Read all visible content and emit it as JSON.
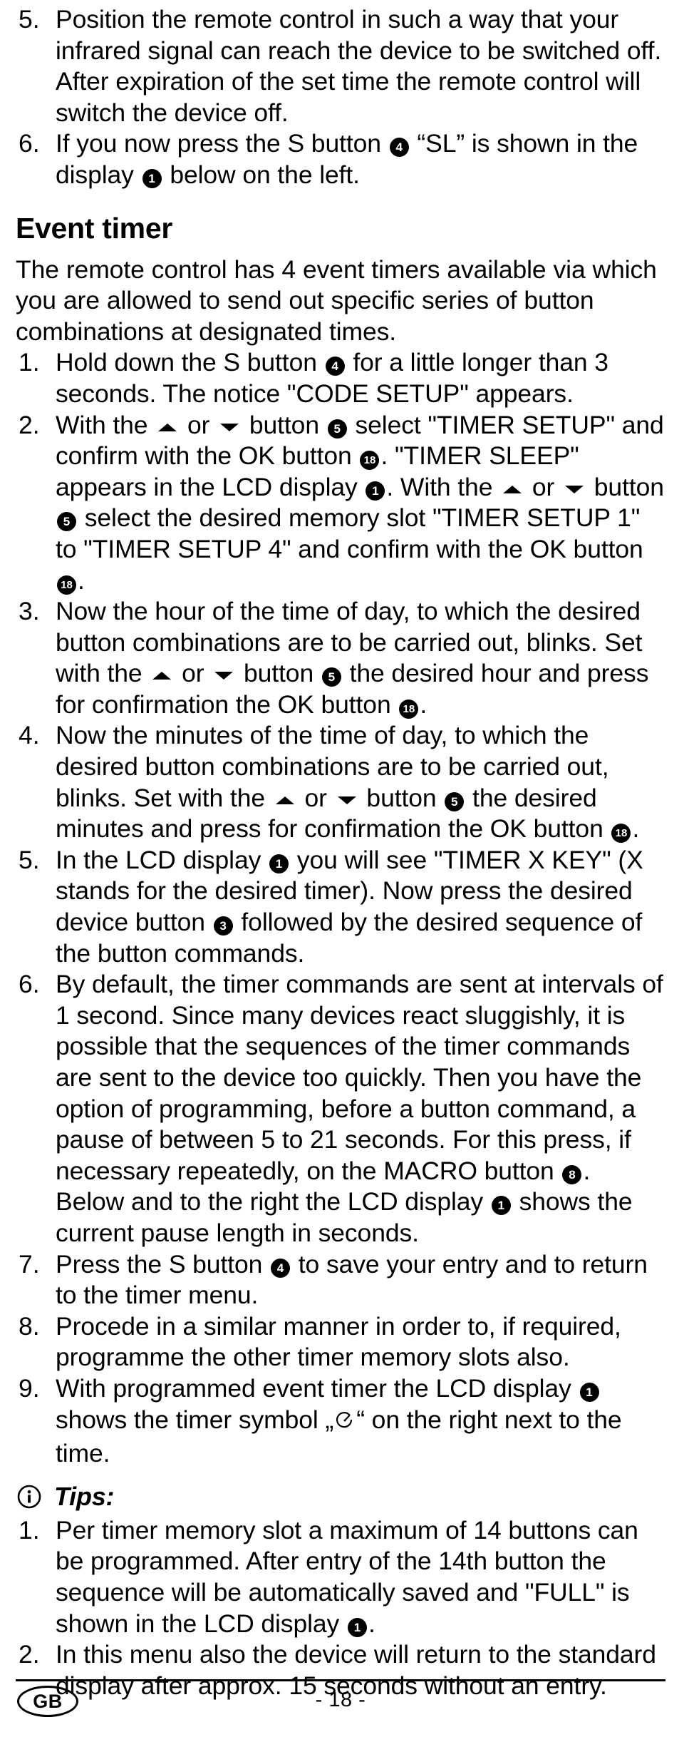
{
  "document": {
    "language_badge": "GB",
    "page_number": "- 18 -"
  },
  "continued_list": {
    "items": [
      {
        "number": "5.",
        "text_parts": [
          {
            "type": "text",
            "value": "Position the remote control in such a way that your infrared signal can reach the device to be switched off. After expiration of the set time the remote control will switch the device off."
          }
        ]
      },
      {
        "number": "6.",
        "text_parts": [
          {
            "type": "text",
            "value": "If you now press the S button "
          },
          {
            "type": "badge",
            "value": "4"
          },
          {
            "type": "text",
            "value": " “SL” is shown in the display "
          },
          {
            "type": "badge",
            "value": "1"
          },
          {
            "type": "text",
            "value": " below on the left."
          }
        ]
      }
    ]
  },
  "section": {
    "heading": "Event timer",
    "intro": "The remote control has 4 event timers available via which you are allowed to send out specific series of button combinations at designated times.",
    "items": [
      {
        "number": "1.",
        "text_parts": [
          {
            "type": "text",
            "value": "Hold down the S button "
          },
          {
            "type": "badge",
            "value": "4"
          },
          {
            "type": "text",
            "value": " for a little longer than 3 seconds. The notice \"CODE SETUP\" appears."
          }
        ]
      },
      {
        "number": "2.",
        "text_parts": [
          {
            "type": "text",
            "value": "With the "
          },
          {
            "type": "arrow-up",
            "value": "▲"
          },
          {
            "type": "text",
            "value": " or "
          },
          {
            "type": "arrow-down",
            "value": "▼"
          },
          {
            "type": "text",
            "value": " button "
          },
          {
            "type": "badge",
            "value": "5"
          },
          {
            "type": "text",
            "value": " select \"TIMER SETUP\" and confirm with the OK button "
          },
          {
            "type": "badge",
            "value": "18"
          },
          {
            "type": "text",
            "value": ". \"TIMER SLEEP\" appears in the LCD display "
          },
          {
            "type": "badge",
            "value": "1"
          },
          {
            "type": "text",
            "value": ".  With the "
          },
          {
            "type": "arrow-up",
            "value": "▲"
          },
          {
            "type": "text",
            "value": " or "
          },
          {
            "type": "arrow-down",
            "value": "▼"
          },
          {
            "type": "text",
            "value": " button "
          },
          {
            "type": "badge",
            "value": "5"
          },
          {
            "type": "text",
            "value": " select the desired memory slot \"TIMER SETUP 1\" to \"TIMER SETUP 4\" and confirm with the OK button "
          },
          {
            "type": "badge",
            "value": "18"
          },
          {
            "type": "text",
            "value": "."
          }
        ]
      },
      {
        "number": "3.",
        "text_parts": [
          {
            "type": "text",
            "value": "Now the hour of the time of day, to which the desired button combinations are to be carried out, blinks. Set with the "
          },
          {
            "type": "arrow-up",
            "value": "▲"
          },
          {
            "type": "text",
            "value": " or "
          },
          {
            "type": "arrow-down",
            "value": "▼"
          },
          {
            "type": "text",
            "value": " button "
          },
          {
            "type": "badge",
            "value": "5"
          },
          {
            "type": "text",
            "value": " the desired hour and press for confirmation the OK button "
          },
          {
            "type": "badge",
            "value": "18"
          },
          {
            "type": "text",
            "value": "."
          }
        ]
      },
      {
        "number": "4.",
        "text_parts": [
          {
            "type": "text",
            "value": "Now the minutes of the time of day, to which the desired button combinations are to be carried out, blinks. Set with the "
          },
          {
            "type": "arrow-up",
            "value": "▲"
          },
          {
            "type": "text",
            "value": " or "
          },
          {
            "type": "arrow-down",
            "value": "▼"
          },
          {
            "type": "text",
            "value": " button "
          },
          {
            "type": "badge",
            "value": "5"
          },
          {
            "type": "text",
            "value": " the desired minutes and press for confirmation the OK button "
          },
          {
            "type": "badge",
            "value": "18"
          },
          {
            "type": "text",
            "value": "."
          }
        ]
      },
      {
        "number": "5.",
        "text_parts": [
          {
            "type": "text",
            "value": "In the LCD display "
          },
          {
            "type": "badge",
            "value": "1"
          },
          {
            "type": "text",
            "value": " you will see \"TIMER X KEY\" (X stands for the desired timer). Now press the desired device button "
          },
          {
            "type": "badge",
            "value": "3"
          },
          {
            "type": "text",
            "value": " followed by the desired sequence of the button commands."
          }
        ]
      },
      {
        "number": "6.",
        "text_parts": [
          {
            "type": "text",
            "value": "By default, the timer commands are sent at intervals of 1 second. Since many devices react sluggishly, it is possible that the sequences of the timer commands are sent to the device too quickly. Then you have the option of programming, before a button command, a pause of between 5 to 21 seconds. For this press, if necessary repeatedly, on the MACRO button "
          },
          {
            "type": "badge",
            "value": "8"
          },
          {
            "type": "text",
            "value": ". Below and to the right the LCD display "
          },
          {
            "type": "badge",
            "value": "1"
          },
          {
            "type": "text",
            "value": " shows the current pause length in seconds."
          }
        ]
      },
      {
        "number": "7.",
        "text_parts": [
          {
            "type": "text",
            "value": "Press the S button "
          },
          {
            "type": "badge",
            "value": "4"
          },
          {
            "type": "text",
            "value": " to save your entry and to return to the timer menu."
          }
        ]
      },
      {
        "number": "8.",
        "text_parts": [
          {
            "type": "text",
            "value": "Procede in a similar manner in order to, if required, programme the other timer memory slots also."
          }
        ]
      },
      {
        "number": "9.",
        "text_parts": [
          {
            "type": "text",
            "value": "With programmed event timer the LCD display "
          },
          {
            "type": "badge",
            "value": "1"
          },
          {
            "type": "text",
            "value": " shows the timer symbol „"
          },
          {
            "type": "clock",
            "value": "clock-symbol"
          },
          {
            "type": "text",
            "value": "“ on the right next to the time."
          }
        ]
      }
    ]
  },
  "tips": {
    "icon": "info-icon",
    "label": "Tips:",
    "items": [
      {
        "number": "1.",
        "text_parts": [
          {
            "type": "text",
            "value": "Per timer memory slot a maximum of 14 buttons can be programmed. After entry of the 14th button the sequence will be automatically saved and \"FULL\" is shown in the LCD display "
          },
          {
            "type": "badge",
            "value": "1"
          },
          {
            "type": "text",
            "value": "."
          }
        ]
      },
      {
        "number": "2.",
        "text_parts": [
          {
            "type": "text",
            "value": "In this menu also the device will return to the standard display after approx. 15 seconds without an entry."
          }
        ]
      }
    ]
  }
}
